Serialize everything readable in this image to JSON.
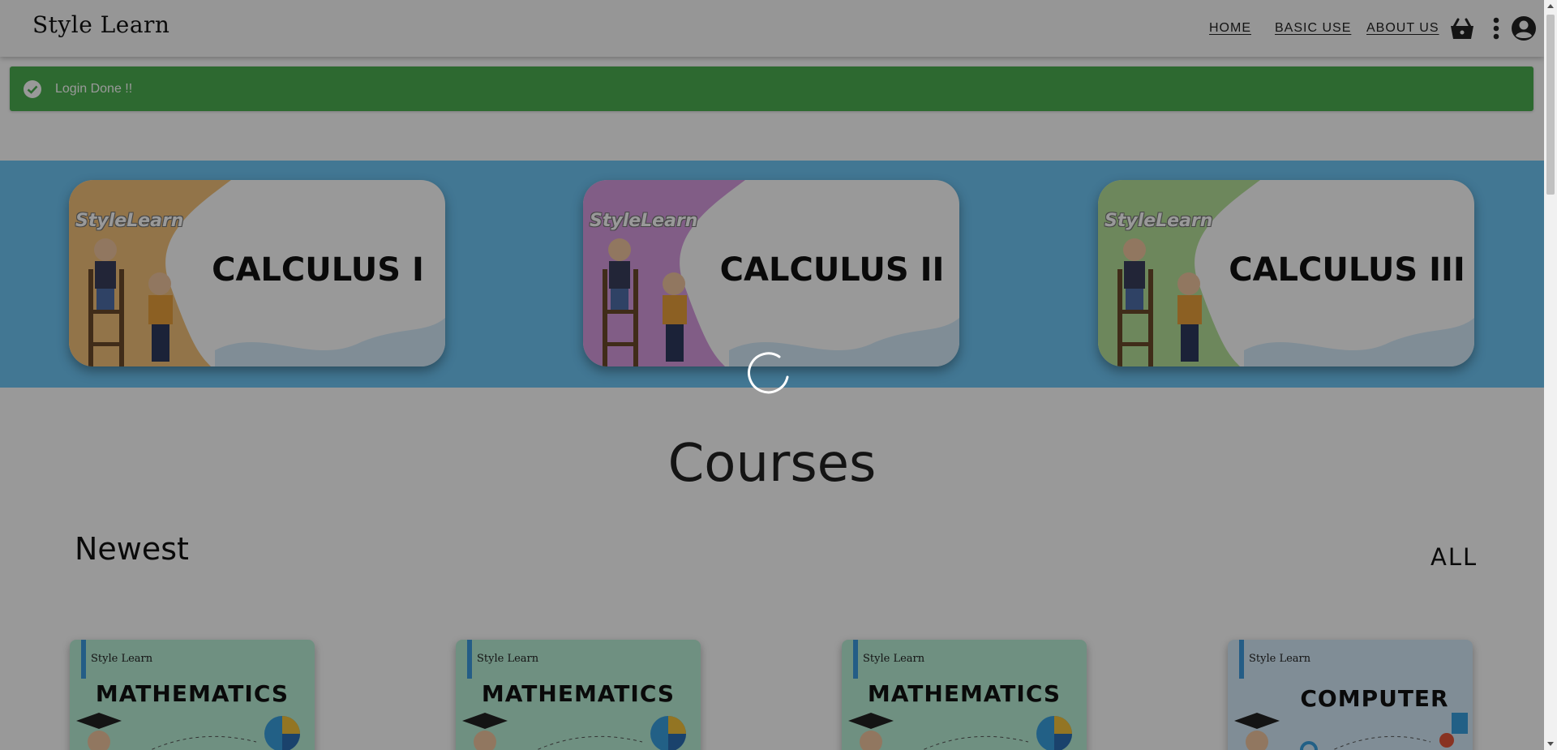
{
  "header": {
    "logo": "Style Learn",
    "nav": {
      "home": "HOME",
      "basic_use": "BASIC USE",
      "about_us": "ABOUT US"
    },
    "icons": {
      "cart": "shopping-basket-icon",
      "more": "more-vert-icon",
      "account": "account-circle-icon"
    }
  },
  "alert": {
    "text": "Login Done !!",
    "icon": "check-circle-icon",
    "color": "#4caf50"
  },
  "hero": {
    "color": "#6ec6f5",
    "cards": [
      {
        "brand": "StyleLearn",
        "title": "CALCULUS I",
        "accent": "#f4c27a"
      },
      {
        "brand": "StyleLearn",
        "title": "CALCULUS II",
        "accent": "#d89be0"
      },
      {
        "brand": "StyleLearn",
        "title": "CALCULUS III",
        "accent": "#b6e29a"
      }
    ]
  },
  "courses": {
    "title": "Courses",
    "section": "Newest",
    "all_link": "ALL",
    "cards": [
      {
        "brand": "Style Learn",
        "title": "MATHEMATICS",
        "bg": "#b9f0d8"
      },
      {
        "brand": "Style Learn",
        "title": "MATHEMATICS",
        "bg": "#b9f0d8"
      },
      {
        "brand": "Style Learn",
        "title": "MATHEMATICS",
        "bg": "#b9f0d8"
      },
      {
        "brand": "Style Learn",
        "title": "COMPUTER",
        "bg": "#d6ecfb"
      }
    ]
  },
  "overlay": {
    "loading": true,
    "spinner_icon": "loading-spinner-icon"
  }
}
